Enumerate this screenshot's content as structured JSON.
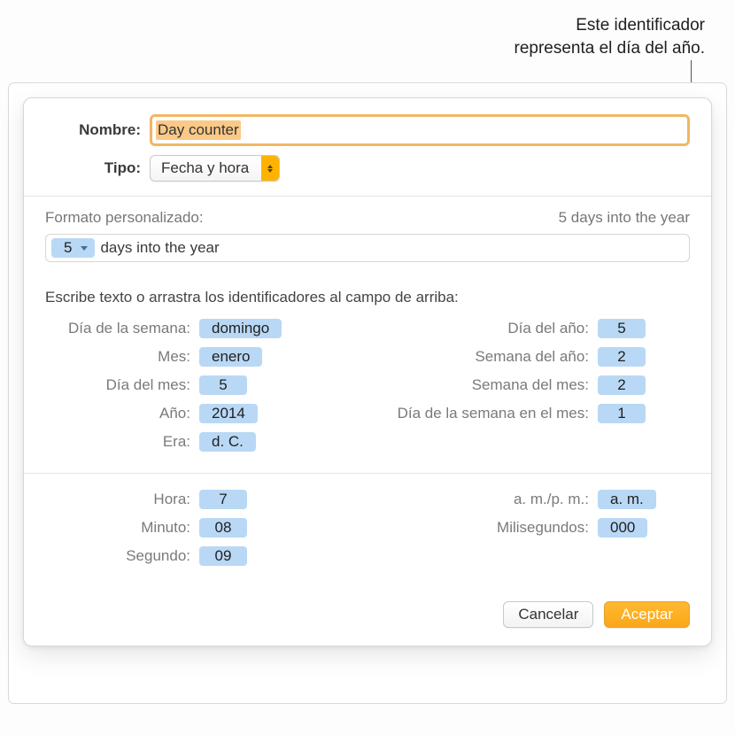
{
  "callout": {
    "line1": "Este identificador",
    "line2": "representa el día del año."
  },
  "labels": {
    "name": "Nombre:",
    "type": "Tipo:",
    "custom_format": "Formato personalizado:",
    "instruction": "Escribe texto o arrastra los identificadores al campo de arriba:"
  },
  "name_value": "Day counter",
  "type_value": "Fecha y hora",
  "format": {
    "token": "5",
    "suffix": " days into the year",
    "preview": "5 days into the year"
  },
  "tokens_left": [
    {
      "label": "Día de la semana:",
      "value": "domingo"
    },
    {
      "label": "Mes:",
      "value": "enero"
    },
    {
      "label": "Día del mes:",
      "value": "5"
    },
    {
      "label": "Año:",
      "value": "2014"
    },
    {
      "label": "Era:",
      "value": "d. C."
    }
  ],
  "tokens_right": [
    {
      "label": "Día del año:",
      "value": "5"
    },
    {
      "label": "Semana del año:",
      "value": "2"
    },
    {
      "label": "Semana del mes:",
      "value": "2"
    },
    {
      "label": "Día de la semana en el mes:",
      "value": "1"
    }
  ],
  "time_left": [
    {
      "label": "Hora:",
      "value": "7"
    },
    {
      "label": "Minuto:",
      "value": "08"
    },
    {
      "label": "Segundo:",
      "value": "09"
    }
  ],
  "time_right": [
    {
      "label": "a. m./p. m.:",
      "value": "a. m."
    },
    {
      "label": "Milisegundos:",
      "value": "000"
    }
  ],
  "buttons": {
    "cancel": "Cancelar",
    "ok": "Aceptar"
  }
}
